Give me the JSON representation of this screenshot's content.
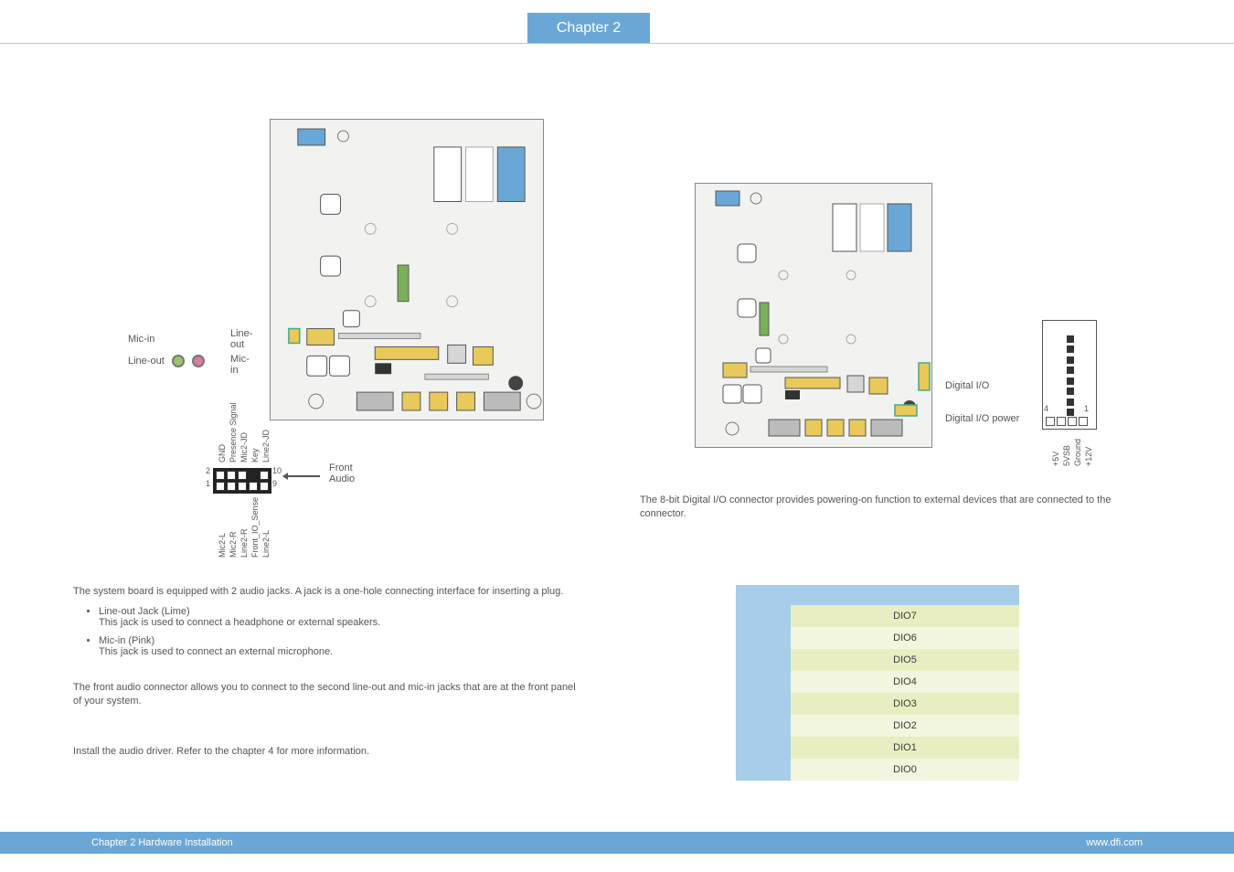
{
  "chapter_tab": "Chapter 2",
  "rear_audio": {
    "mic_in_top": "Mic-in",
    "line_out_top": "Line-out",
    "line_out_left": "Line-out",
    "mic_in_right": "Mic-in"
  },
  "front_audio_header": {
    "label_line1": "Front",
    "label_line2": "Audio",
    "top_pins": [
      "GND",
      "Presence Signal",
      "Mic2-JD",
      "Key",
      "Line2-JD"
    ],
    "bottom_pins": [
      "Mic2-L",
      "Mic2-R",
      "Line2-R",
      "Front_IO_Sense",
      "Line2-L"
    ],
    "num_2": "2",
    "num_1": "1",
    "num_10": "10",
    "num_9": "9"
  },
  "rear_audio_section": {
    "para": "The system board is equipped with 2 audio jacks. A jack is a one-hole connecting interface for inserting a plug.",
    "bullet1_title": "Line-out Jack (Lime)",
    "bullet1_body": "This jack is used to connect a headphone or external speakers.",
    "bullet2_title": "Mic-in (Pink)",
    "bullet2_body": "This jack is used to connect an external microphone."
  },
  "front_audio_section": {
    "para": "The front audio connector allows you to connect to the second line-out and mic-in jacks that are at the front panel of your system."
  },
  "driver_section": {
    "para": "Install the audio driver. Refer to the chapter 4 for more information."
  },
  "digital_io": {
    "label_a": "Digital I/O",
    "label_b": "Digital I/O power",
    "para": "The 8-bit Digital I/O connector provides powering-on function to external devices that are connected to the connector.",
    "pin4_labels": {
      "p4": "4",
      "p1": "1"
    },
    "power_pins": [
      "+5V",
      "5VSB",
      "Ground",
      "+12V"
    ]
  },
  "io_table": {
    "rows": [
      {
        "pin": "",
        "fn": ""
      },
      {
        "pin": "",
        "fn": "DIO7"
      },
      {
        "pin": "",
        "fn": "DIO6"
      },
      {
        "pin": "",
        "fn": "DIO5"
      },
      {
        "pin": "",
        "fn": "DIO4"
      },
      {
        "pin": "",
        "fn": "DIO3"
      },
      {
        "pin": "",
        "fn": "DIO2"
      },
      {
        "pin": "",
        "fn": "DIO1"
      },
      {
        "pin": "",
        "fn": "DIO0"
      }
    ]
  },
  "footer": {
    "left": "Chapter 2 Hardware Installation",
    "right": "www.dfi.com"
  }
}
